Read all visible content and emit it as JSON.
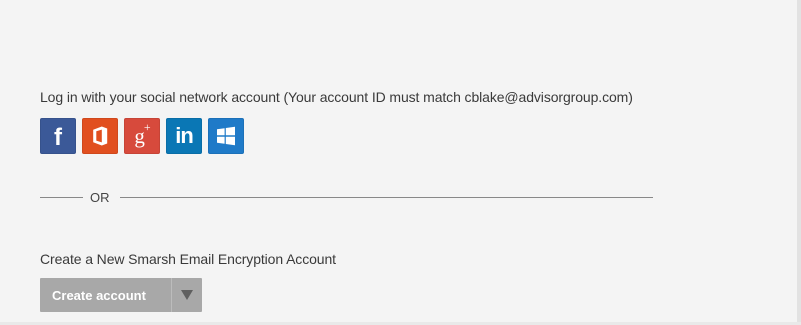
{
  "social": {
    "prompt": "Log in with your social network account (Your account ID must match cblake@advisorgroup.com)",
    "providers": [
      {
        "name": "Facebook",
        "icon": "facebook-icon",
        "glyph": "f",
        "color": "#3b5998"
      },
      {
        "name": "Office 365",
        "icon": "office-icon",
        "glyph": "",
        "color": "#e14f1f"
      },
      {
        "name": "Google+",
        "icon": "googleplus-icon",
        "glyph": "g+",
        "color": "#d74a3c"
      },
      {
        "name": "LinkedIn",
        "icon": "linkedin-icon",
        "glyph": "in",
        "color": "#0a77b5"
      },
      {
        "name": "Windows",
        "icon": "windows-icon",
        "glyph": "",
        "color": "#1f7ac8"
      }
    ]
  },
  "separator": {
    "label": "OR"
  },
  "create": {
    "prompt": "Create a New Smarsh Email Encryption Account",
    "button_label": "Create account",
    "dropdown_icon": "caret-down-icon"
  },
  "colors": {
    "background": "#f4f4f4",
    "text": "#3a3a3a",
    "button": "#a8a8a8",
    "separator": "#888888"
  }
}
